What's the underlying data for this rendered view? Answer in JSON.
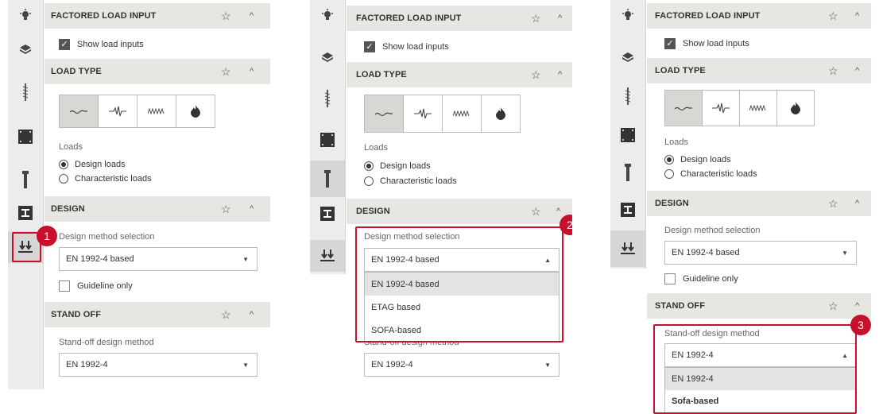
{
  "sections": {
    "factored_load_input": "FACTORED LOAD INPUT",
    "load_type": "LOAD TYPE",
    "design": "DESIGN",
    "stand_off": "STAND OFF"
  },
  "labels": {
    "show_load_inputs": "Show load inputs",
    "loads": "Loads",
    "design_loads": "Design loads",
    "characteristic_loads": "Characteristic loads",
    "design_method_selection": "Design method selection",
    "guideline_only": "Guideline only",
    "standoff_design_method": "Stand-off design method"
  },
  "values": {
    "design_method": "EN 1992-4 based",
    "standoff_method": "EN 1992-4"
  },
  "design_method_options": [
    "EN 1992-4 based",
    "ETAG based",
    "SOFA-based"
  ],
  "standoff_options": [
    "EN 1992-4",
    "Sofa-based"
  ],
  "icons": {
    "star": "☆",
    "collapse": "^",
    "dropdown_closed": "▼",
    "dropdown_open": "▲",
    "check": "✓"
  },
  "badges": [
    "1",
    "2",
    "3"
  ],
  "colors": {
    "accent": "#c8102e",
    "section_bg": "#e8e6e3",
    "sidebar_bg": "#ececec"
  }
}
